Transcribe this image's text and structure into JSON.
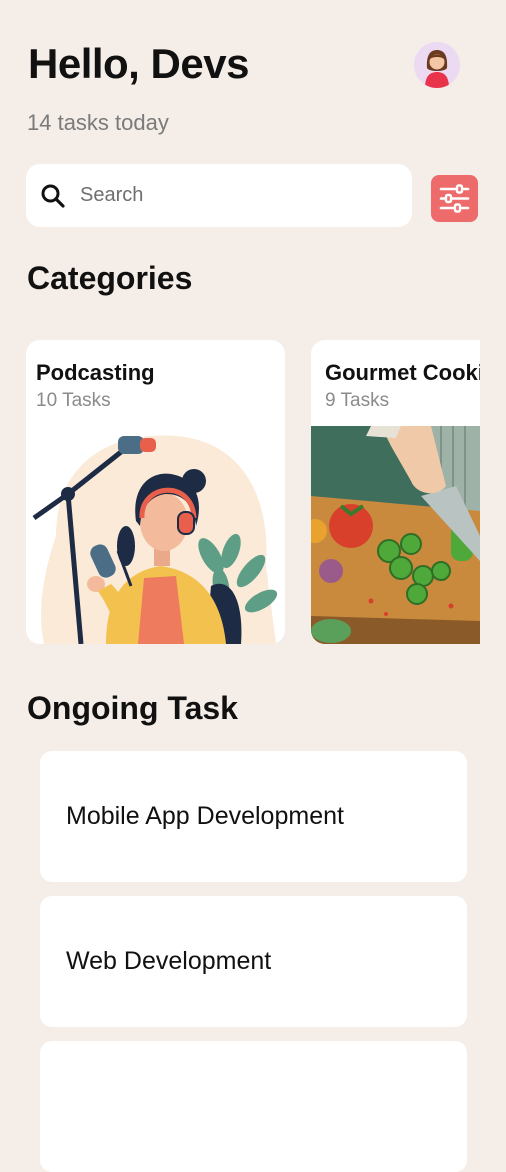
{
  "header": {
    "greeting": "Hello, Devs",
    "subtitle": "14 tasks today",
    "avatar_icon": "woman-avatar-icon"
  },
  "search": {
    "placeholder": "Search",
    "icon": "search-icon",
    "filter_icon": "sliders-icon",
    "filter_color": "#ee6b6b"
  },
  "categories": {
    "title": "Categories",
    "items": [
      {
        "name": "Podcasting",
        "count": "10 Tasks",
        "image": "podcaster-illustration"
      },
      {
        "name": "Gourmet Cooking",
        "count": "9 Tasks",
        "image": "cooking-illustration"
      }
    ]
  },
  "ongoing": {
    "title": "Ongoing Task",
    "items": [
      {
        "label": "Mobile App Development"
      },
      {
        "label": "Web Development"
      },
      {
        "label": ""
      }
    ]
  },
  "colors": {
    "background": "#f5eee8",
    "card": "#ffffff",
    "accent": "#ee6b6b"
  }
}
